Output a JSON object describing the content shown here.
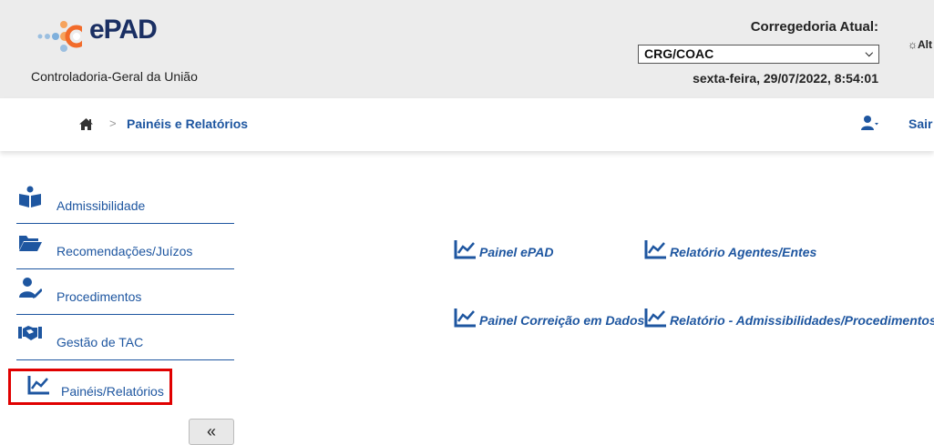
{
  "header": {
    "logo_text": "ePAD",
    "org_name": "Controladoria-Geral da União",
    "corregedoria_label": "Corregedoria Atual:",
    "corregedoria_selected": "CRG/COAC",
    "datetime": "sexta-feira, 29/07/2022, 8:54:01",
    "theme_toggle_label": "Alt"
  },
  "breadcrumb": {
    "separator": ">",
    "current": "Painéis e Relatórios"
  },
  "user_menu": {
    "logout_label": "Sair"
  },
  "sidebar": {
    "items": [
      {
        "label": "Admissibilidade",
        "icon": "reader-icon"
      },
      {
        "label": "Recomendações/Juízos",
        "icon": "folder-open-icon"
      },
      {
        "label": "Procedimentos",
        "icon": "user-edit-icon"
      },
      {
        "label": "Gestão de TAC",
        "icon": "handshake-icon"
      },
      {
        "label": "Painéis/Relatórios",
        "icon": "chart-line-icon",
        "selected": true
      }
    ],
    "collapse_label": "«"
  },
  "main": {
    "links": [
      {
        "label": "Painel ePAD",
        "icon": "chart-line-icon"
      },
      {
        "label": "Relatório Agentes/Entes",
        "icon": "chart-line-icon"
      },
      {
        "label": "Painel Correição em Dados",
        "icon": "chart-line-icon"
      },
      {
        "label": "Relatório - Admissibilidades/Procedimentos",
        "icon": "chart-line-icon"
      }
    ]
  },
  "colors": {
    "brand_blue": "#1e56a0",
    "logo_orange": "#f26b2a",
    "selection_red": "#e00000",
    "header_bg": "#ececec"
  }
}
